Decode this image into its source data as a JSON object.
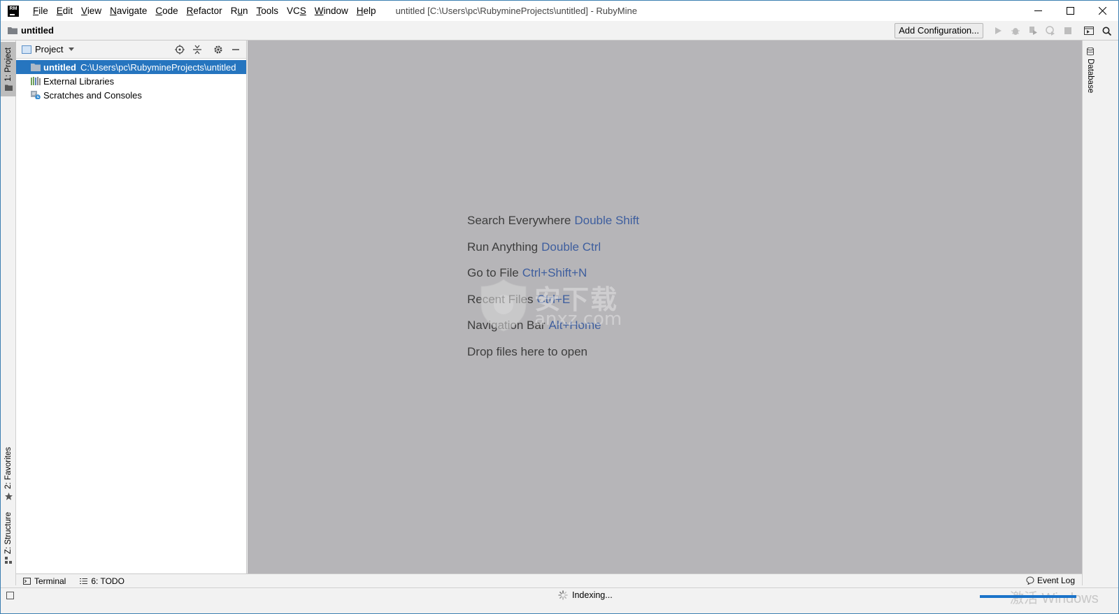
{
  "titlebar": {
    "logo_text": "RM",
    "menu": [
      {
        "pre": "",
        "mn": "F",
        "post": "ile"
      },
      {
        "pre": "",
        "mn": "E",
        "post": "dit"
      },
      {
        "pre": "",
        "mn": "V",
        "post": "iew"
      },
      {
        "pre": "",
        "mn": "N",
        "post": "avigate"
      },
      {
        "pre": "",
        "mn": "C",
        "post": "ode"
      },
      {
        "pre": "",
        "mn": "R",
        "post": "efactor"
      },
      {
        "pre": "R",
        "mn": "u",
        "post": "n"
      },
      {
        "pre": "",
        "mn": "T",
        "post": "ools"
      },
      {
        "pre": "VC",
        "mn": "S",
        "post": ""
      },
      {
        "pre": "",
        "mn": "W",
        "post": "indow"
      },
      {
        "pre": "",
        "mn": "H",
        "post": "elp"
      }
    ],
    "window_title": "untitled [C:\\Users\\pc\\RubymineProjects\\untitled] - RubyMine"
  },
  "navbar": {
    "breadcrumb": "untitled",
    "add_configuration": "Add Configuration..."
  },
  "left_stripe": {
    "project": "1: Project",
    "favorites": "2: Favorites",
    "structure": "Z: Structure"
  },
  "project_panel": {
    "title": "Project",
    "rows": {
      "root_name": "untitled",
      "root_path": "C:\\Users\\pc\\RubymineProjects\\untitled",
      "external_libraries": "External Libraries",
      "scratches": "Scratches and Consoles"
    }
  },
  "editor_hints": [
    {
      "label": "Search Everywhere",
      "shortcut": "Double Shift"
    },
    {
      "label": "Run Anything",
      "shortcut": "Double Ctrl"
    },
    {
      "label": "Go to File",
      "shortcut": "Ctrl+Shift+N"
    },
    {
      "label": "Recent Files",
      "shortcut": "Ctrl+E"
    },
    {
      "label": "Navigation Bar",
      "shortcut": "Alt+Home"
    },
    {
      "label": "Drop files here to open",
      "shortcut": ""
    }
  ],
  "watermark": {
    "line1": "安下载",
    "line2": "anxz.com"
  },
  "right_stripe": {
    "database": "Database"
  },
  "bottom_bar": {
    "terminal": "Terminal",
    "todo": "6: TODO",
    "event_log": "Event Log"
  },
  "status_bar": {
    "indexing": "Indexing...",
    "activate_watermark": "激活 Windows"
  },
  "colors": {
    "selection": "#2675bf",
    "editor_bg": "#b6b5b8",
    "shortcut": "#3e5e9e"
  }
}
